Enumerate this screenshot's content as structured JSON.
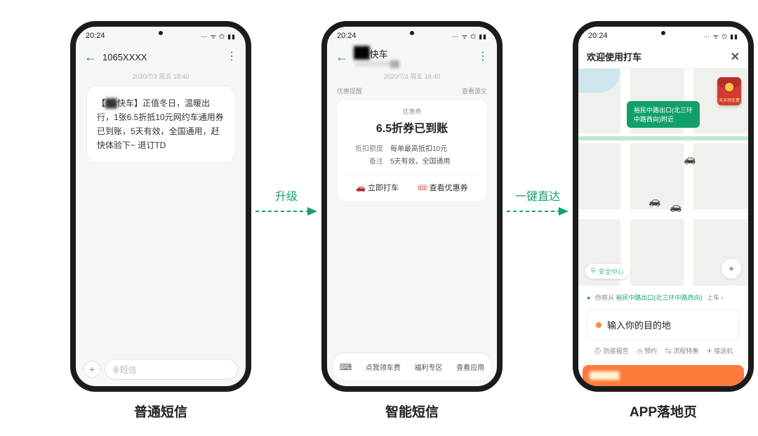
{
  "status_time": "20:24",
  "status_icons": "⋯ ᯤ ⏻ ▮▮",
  "phone1": {
    "sender": "1065XXXX",
    "timestamp": "2020/7/3 周五 18:40",
    "sms_prefix_blur": "██",
    "sms_text_a": "【",
    "sms_text_b": "快车】正值冬日，温暖出行，1张6.5折抵10元网约车通用券已到账，5天有效，全国通用，赶快体验下~ 退订TD",
    "input_placeholder": "短信"
  },
  "phone2": {
    "sender_blur": "██",
    "sender_suffix": "快车",
    "sender_sub_blur": "1065302580██",
    "timestamp": "2020/7/3 周五 18:40",
    "tag_left": "优惠提醒",
    "tag_right": "查看源文",
    "card_pill": "优惠券",
    "card_headline": "6.5折券已到账",
    "kv1_k": "抵扣额度",
    "kv1_v": "每单最高抵扣10元",
    "kv2_k": "备注",
    "kv2_v": "5天有效，全国通用",
    "action1": "立即打车",
    "action2": "查看优惠券",
    "tb1": "点我领车费",
    "tb2": "福利专区",
    "tb3": "查看应用"
  },
  "phone3": {
    "title": "欢迎使用打车",
    "map_pill_l1": "裕民中路出口(北三环",
    "map_pill_l2": "中路西向)附近",
    "red_env_label": "天天领车费",
    "shield": "安全中心",
    "from_prefix": "你将从",
    "from_hl": "裕民中路出口(北三环中路西向)",
    "from_suffix": "上车 ›",
    "dest_placeholder": "输入你的目的地",
    "nav1": "防疫报告",
    "nav2": "预约",
    "nav3": "流程特惠",
    "nav4": "接送机",
    "promo_text_blur": "██████"
  },
  "arrow1_label": "升级",
  "arrow2_label": "一键直达",
  "caption1": "普通短信",
  "caption2": "智能短信",
  "caption3": "APP落地页"
}
